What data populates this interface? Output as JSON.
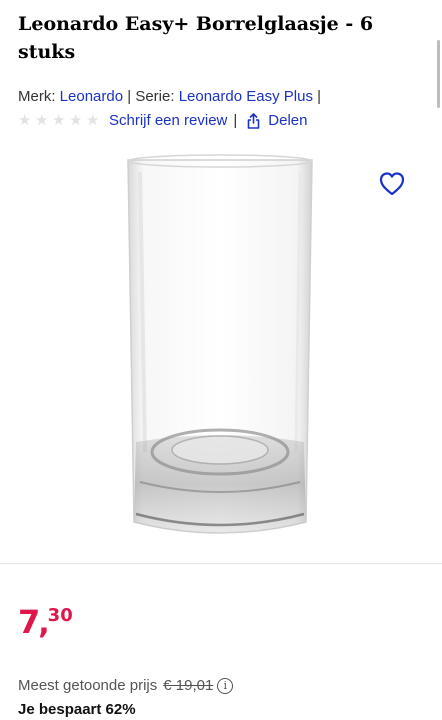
{
  "product": {
    "title": "Leonardo Easy+ Borrelglaasje - 6 stuks"
  },
  "meta": {
    "brand_label": "Merk:",
    "brand_value": "Leonardo",
    "separator": "|",
    "series_label": "Serie:",
    "series_value": "Leonardo Easy Plus"
  },
  "reviews": {
    "rating_stars": 0,
    "write_review_label": "Schrijf een review",
    "separator": "|",
    "share_label": "Delen"
  },
  "price": {
    "euros": "7",
    "comma": ",",
    "cents": "30",
    "color": "#e0164b"
  },
  "compare": {
    "label": "Meest getoonde prijs",
    "old_price": "€ 19,01",
    "info_icon": "i"
  },
  "saving": {
    "label": "Je bespaart 62%"
  },
  "colors": {
    "link": "#1b32c6",
    "star_empty": "#e3e3e6"
  },
  "icons": {
    "wishlist": "heart-icon",
    "share": "share-icon",
    "info": "info-icon",
    "star": "star-icon"
  }
}
